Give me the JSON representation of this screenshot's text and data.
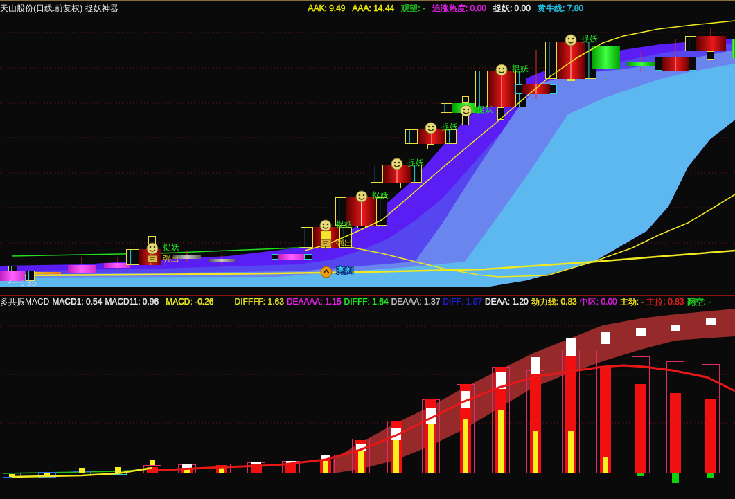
{
  "header": {
    "title": "天山股份(日线.前复权) 捉妖神器",
    "indicators": [
      {
        "text": "AAK: 9.49",
        "color": "#f0f000"
      },
      {
        "text": "AAA: 14.44",
        "color": "#f0f000"
      },
      {
        "text": "观望: -",
        "color": "#20c820"
      },
      {
        "text": "追涨热度: 0.00",
        "color": "#f020f0"
      },
      {
        "text": "捉妖: 0.00",
        "color": "#f0f0f0"
      },
      {
        "text": "黄牛线: 7.80",
        "color": "#20c8e8"
      }
    ]
  },
  "price_chart": {
    "signals": [
      {
        "kind": "catch",
        "label": "捉妖"
      },
      {
        "kind": "breakout",
        "label": "强出"
      },
      {
        "kind": "catch",
        "label": "捉妖"
      },
      {
        "kind": "breakout",
        "label": "强出"
      },
      {
        "kind": "arrow",
        "label": "亮剑"
      },
      {
        "kind": "catch",
        "label": "捉妖"
      },
      {
        "kind": "catch",
        "label": "捉妖"
      },
      {
        "kind": "catch",
        "label": "捉妖"
      },
      {
        "kind": "catch",
        "label": "捉妖"
      },
      {
        "kind": "catch",
        "label": "捉妖"
      },
      {
        "kind": "catch",
        "label": "捉妖"
      }
    ],
    "price_label": "6.85"
  },
  "macd_header": {
    "title": "多共振MACD",
    "indicators": [
      {
        "text": "MACD1: 0.54",
        "color": "#e8e8e8"
      },
      {
        "text": "MACD11: 0.96",
        "color": "#e8e8e8"
      },
      {
        "text": "MACD: -0.26",
        "color": "#f0f020"
      },
      {
        "text": "DIFFFF: 1.63",
        "color": "#e0e020"
      },
      {
        "text": "DEAAAA: 1.15",
        "color": "#f020f0"
      },
      {
        "text": "DIFFF: 1.64",
        "color": "#20f020"
      },
      {
        "text": "DEAAA: 1.37",
        "color": "#c0c0c0"
      },
      {
        "text": "DIFF: 1.07",
        "color": "#2020d0"
      },
      {
        "text": "DEAA: 1.20",
        "color": "#f0f0f0"
      },
      {
        "text": "动力线: 0.83",
        "color": "#f0e020"
      },
      {
        "text": "中区: 0.00",
        "color": "#e020e0"
      },
      {
        "text": "主动: -",
        "color": "#f0e020"
      },
      {
        "text": "主拉: 0.83",
        "color": "#f02020"
      },
      {
        "text": "翻空: -",
        "color": "#20e020"
      }
    ]
  }
}
